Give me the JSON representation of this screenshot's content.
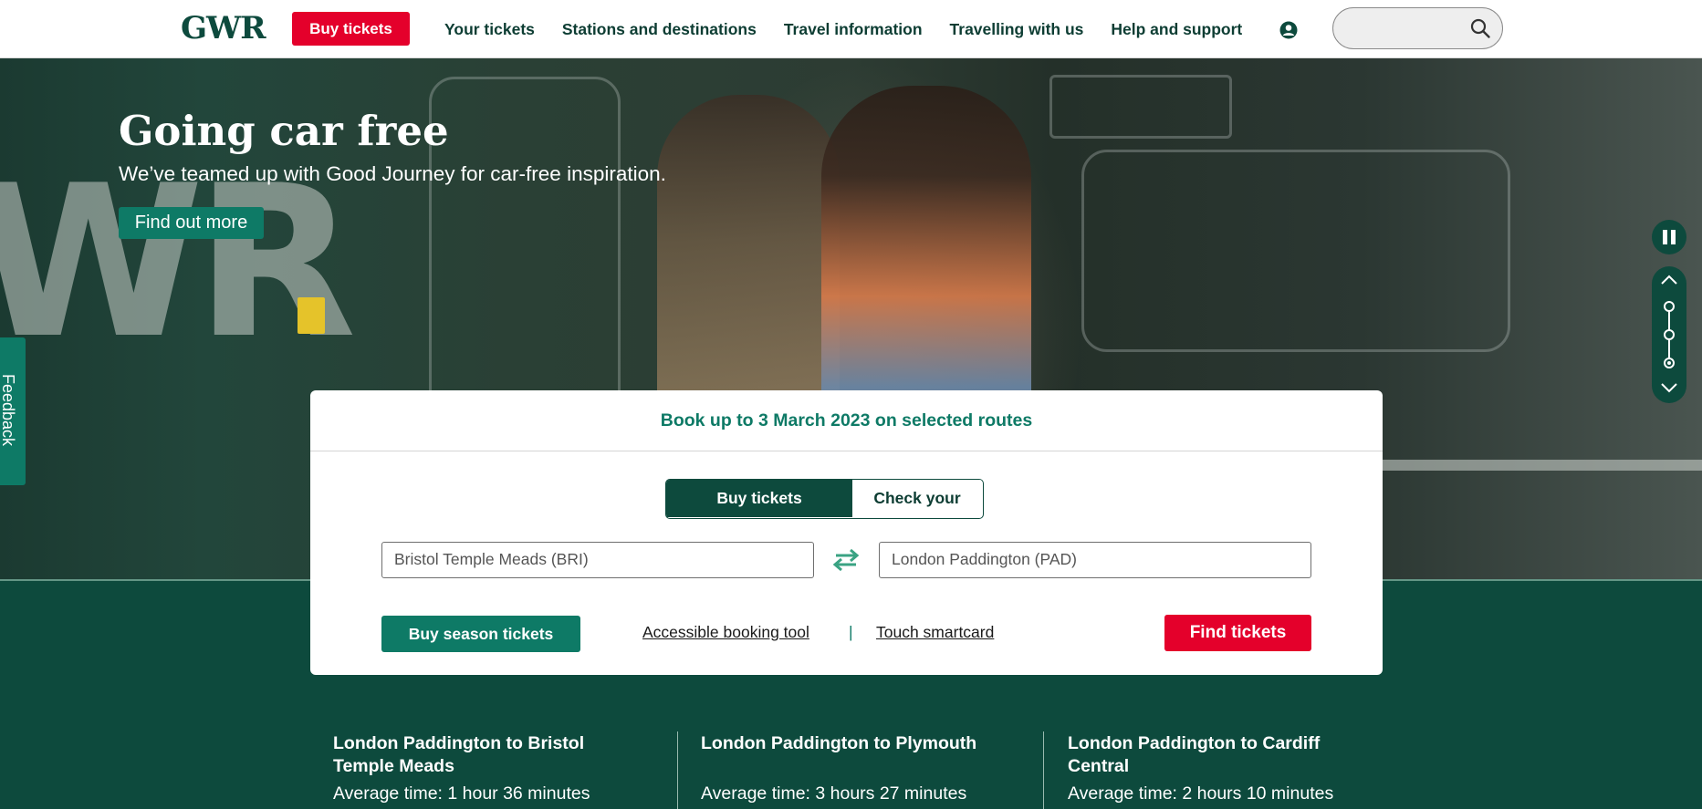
{
  "header": {
    "logo_text": "GWR",
    "buy_tickets_label": "Buy tickets",
    "nav": [
      "Your tickets",
      "Stations and destinations",
      "Travel information",
      "Travelling with us",
      "Help and support"
    ],
    "account_icon": "user-circle-icon",
    "search": {
      "value": "",
      "icon": "search-icon"
    }
  },
  "hero": {
    "title": "Going car free",
    "subtitle": "We’ve teamed up with Good Journey for car-free inspiration.",
    "cta_label": "Find out more",
    "carousel": {
      "total_slides": 3,
      "active_slide": 3
    }
  },
  "feedback": {
    "label": "Feedback"
  },
  "booking": {
    "headline": "Book up to 3 March 2023 on selected routes",
    "tabs": [
      "Buy tickets",
      "Check your journey"
    ],
    "active_tab": "Buy tickets",
    "from_station": "Bristol Temple Meads (BRI)",
    "to_station": "London Paddington (PAD)",
    "season_label": "Buy season tickets",
    "accessible_link": "Accessible booking tool",
    "separator": "|",
    "smartcard_link": "Touch smartcard",
    "find_label": "Find tickets"
  },
  "routes": [
    {
      "title": "London Paddington to Bristol Temple Meads",
      "time": "Average time: 1 hour 36 minutes"
    },
    {
      "title": "London Paddington to Plymouth",
      "time": "Average time: 3 hours 27 minutes"
    },
    {
      "title": "London Paddington to Cardiff Central",
      "time": "Average time: 2 hours 10 minutes"
    }
  ],
  "colors": {
    "brand_green": "#0d4a3d",
    "accent_teal": "#0e7a66",
    "cta_red": "#e4002b"
  }
}
